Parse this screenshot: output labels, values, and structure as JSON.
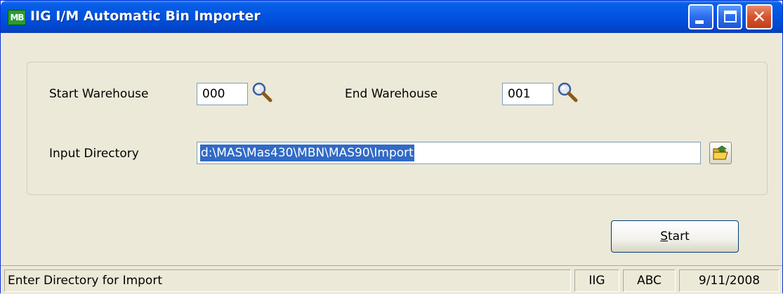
{
  "window": {
    "title": "IIG I/M  Automatic Bin Importer",
    "app_icon_text": "MB"
  },
  "form": {
    "start_warehouse_label": "Start Warehouse",
    "start_warehouse_value": "000",
    "end_warehouse_label": "End Warehouse",
    "end_warehouse_value": "001",
    "input_directory_label": "Input Directory",
    "input_directory_value": "d:\\MAS\\Mas430\\MBN\\MAS90\\Import"
  },
  "buttons": {
    "start_label_underlined": "S",
    "start_label_rest": "tart"
  },
  "statusbar": {
    "message": "Enter Directory for Import",
    "company_code": "IIG",
    "user_code": "ABC",
    "date": "9/11/2008"
  },
  "icons": {
    "lookup": "magnifier-icon",
    "browse": "folder-open-icon",
    "minimize": "minimize-icon",
    "maximize": "maximize-icon",
    "close": "close-icon"
  },
  "colors": {
    "titlebar": "#0054e3",
    "window_bg": "#ece9d8",
    "selection": "#316ac5"
  }
}
